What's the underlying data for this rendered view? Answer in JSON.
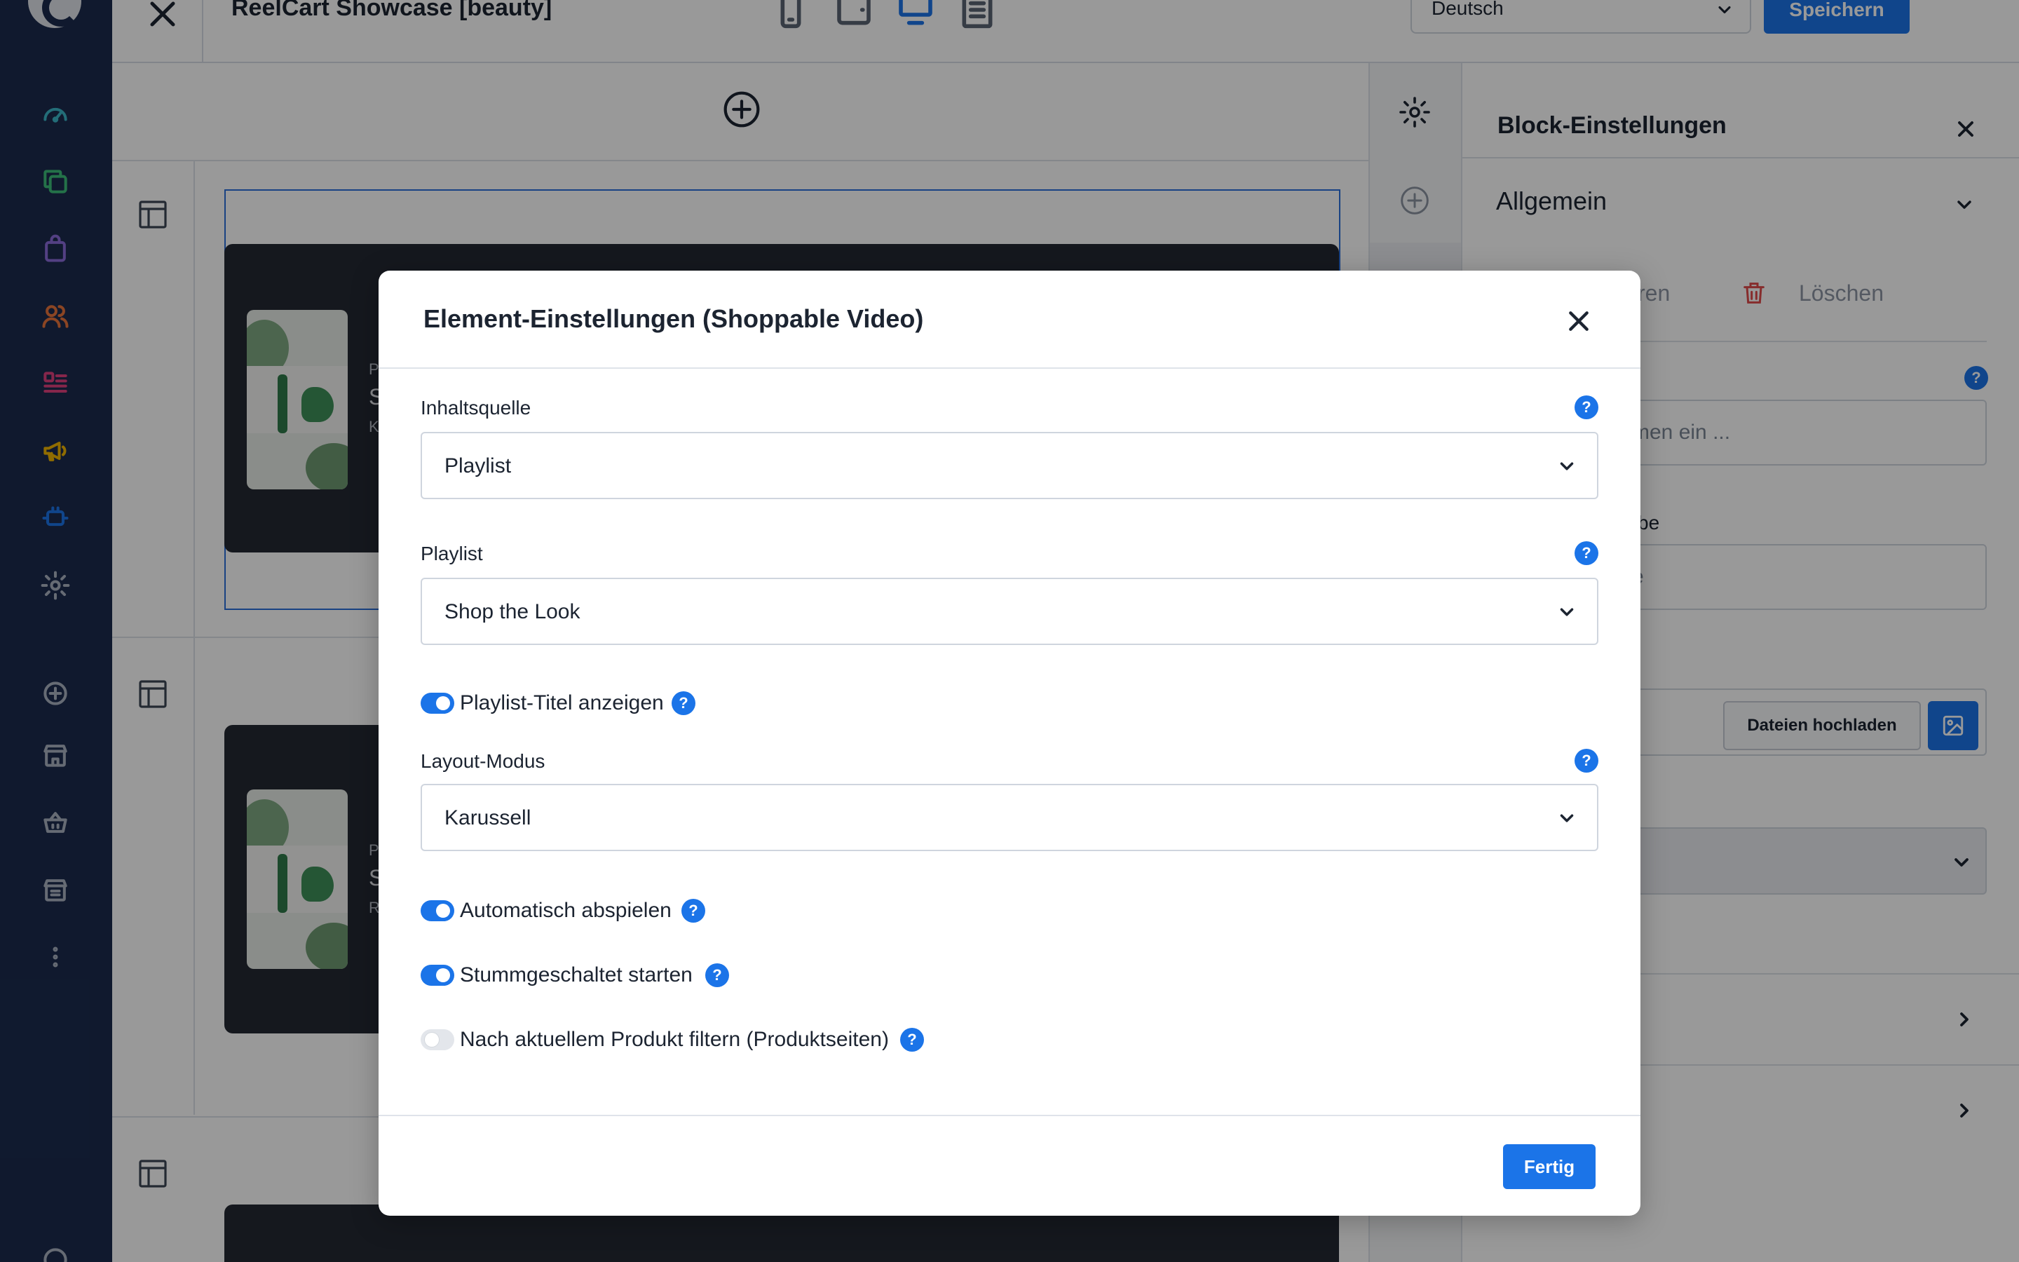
{
  "topbar": {
    "title": "ReelCart Showcase [beauty]",
    "language": "Deutsch",
    "save_label": "Speichern"
  },
  "nav": {
    "items": [
      "dashboard-icon",
      "catalogue-icon",
      "orders-icon",
      "customers-icon",
      "content-icon",
      "marketing-icon",
      "extensions-icon",
      "settings-icon",
      "add-icon",
      "sales-channel-icon",
      "basket-icon",
      "storefront-icon",
      "more-icon"
    ]
  },
  "canvas": {
    "card_prefix_1": "P",
    "card_prefix_2": "S",
    "card_prefix_3": "K",
    "card2_prefix_1": "P",
    "card2_prefix_2": "S",
    "card2_prefix_3": "R"
  },
  "settings_panel": {
    "title": "Block-Einstellungen",
    "section": "Allgemein",
    "action_partial": "ren",
    "delete_label": "Löschen",
    "name_placeholder_partial": "men ein ...",
    "label_partial": "be",
    "input_partial": "e",
    "upload_label": "Dateien hochladen"
  },
  "modal": {
    "title": "Element-Einstellungen (Shoppable Video)",
    "source_label": "Inhaltsquelle",
    "source_value": "Playlist",
    "playlist_label": "Playlist",
    "playlist_value": "Shop the Look",
    "show_title_label": "Playlist-Titel anzeigen",
    "show_title_on": true,
    "layout_label": "Layout-Modus",
    "layout_value": "Karussell",
    "autoplay_label": "Automatisch abspielen",
    "autoplay_on": true,
    "muted_label": "Stummgeschaltet starten",
    "muted_on": true,
    "filter_label": "Nach aktuellem Produkt filtern (Produktseiten)",
    "filter_on": false,
    "done_label": "Fertig",
    "help_symbol": "?"
  },
  "colors": {
    "accent": "#1b74e8",
    "nav_bg": "#1b2b4e",
    "card_bg": "#232833"
  }
}
